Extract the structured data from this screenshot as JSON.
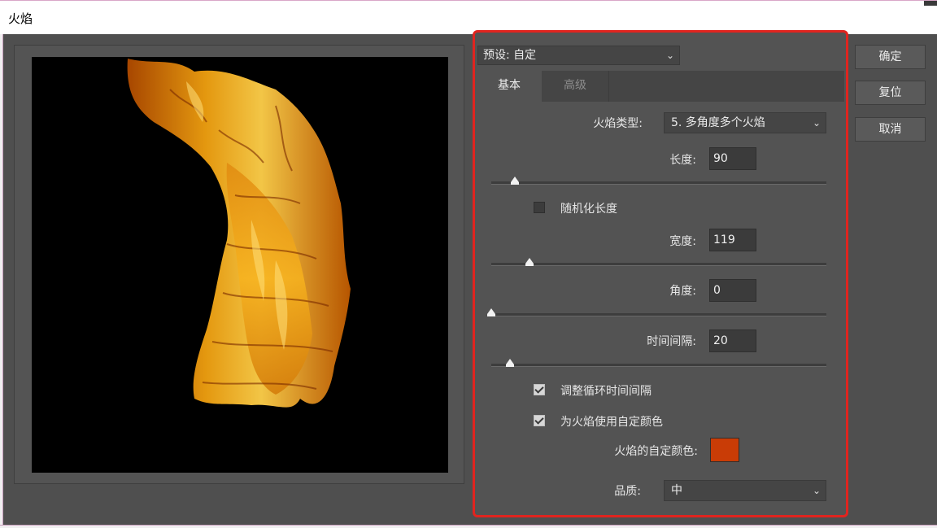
{
  "window": {
    "title": "火焰"
  },
  "preset": {
    "label": "预设: 自定"
  },
  "tabs": [
    {
      "label": "基本",
      "active": true
    },
    {
      "label": "高级",
      "active": false
    }
  ],
  "flame_type": {
    "label": "火焰类型:",
    "value": "5. 多角度多个火焰"
  },
  "length": {
    "label": "长度:",
    "value": "90",
    "slider_fraction": 0.07
  },
  "randomize_length": {
    "label": "随机化长度",
    "checked": false
  },
  "width": {
    "label": "宽度:",
    "value": "119",
    "slider_fraction": 0.115
  },
  "angle": {
    "label": "角度:",
    "value": "0",
    "slider_fraction": 0.0
  },
  "interval": {
    "label": "时间间隔:",
    "value": "20",
    "slider_fraction": 0.055
  },
  "adjust_loop": {
    "label": "调整循环时间间隔",
    "checked": true
  },
  "custom_color": {
    "label": "为火焰使用自定颜色",
    "checked": true
  },
  "custom_color_swatch": {
    "label": "火焰的自定颜色:",
    "color": "#c93c06"
  },
  "quality": {
    "label": "品质:",
    "value": "中"
  },
  "buttons": {
    "ok": "确定",
    "reset": "复位",
    "cancel": "取消"
  },
  "colors": {
    "highlight_border": "#e0241f",
    "panel": "#535353"
  }
}
